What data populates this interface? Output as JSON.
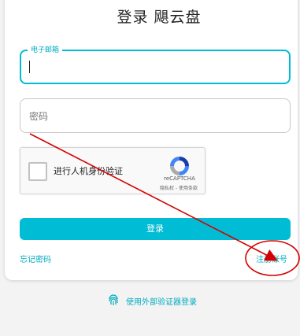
{
  "title": "登录 飓云盘",
  "email": {
    "label": "电子邮箱",
    "value": ""
  },
  "password": {
    "placeholder": "密码"
  },
  "captcha": {
    "text": "进行人机身份验证",
    "brand": "reCAPTCHA",
    "links": "隐私权 - 使用条款"
  },
  "login_button": "登录",
  "forgot_password": "忘记密码",
  "register": "注册账号",
  "external_auth": "使用外部验证器登录",
  "colors": {
    "accent": "#00bcd4",
    "logo": "#8bc34a",
    "annotation": "#d50000"
  }
}
